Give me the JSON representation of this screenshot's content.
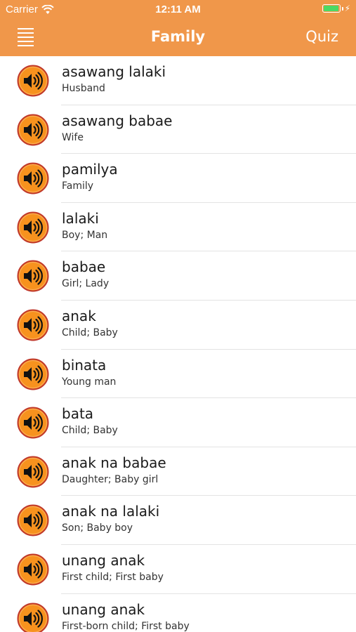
{
  "colors": {
    "accent": "#f0974a",
    "speaker_fill": "#f7921e",
    "speaker_ring": "#c0392b",
    "battery_fill": "#4cd964"
  },
  "status_bar": {
    "carrier": "Carrier",
    "time": "12:11 AM",
    "icons": [
      "wifi-icon",
      "battery-icon",
      "charging-bolt-icon"
    ]
  },
  "navbar": {
    "menu_icon": "hamburger-menu-icon",
    "title": "Family",
    "right_button": "Quiz"
  },
  "items": [
    {
      "word": "asawang lalaki",
      "translation": "Husband",
      "icon": "speaker-icon"
    },
    {
      "word": "asawang babae",
      "translation": "Wife",
      "icon": "speaker-icon"
    },
    {
      "word": "pamilya",
      "translation": "Family",
      "icon": "speaker-icon"
    },
    {
      "word": "lalaki",
      "translation": "Boy; Man",
      "icon": "speaker-icon"
    },
    {
      "word": "babae",
      "translation": "Girl; Lady",
      "icon": "speaker-icon"
    },
    {
      "word": "anak",
      "translation": "Child; Baby",
      "icon": "speaker-icon"
    },
    {
      "word": "binata",
      "translation": "Young man",
      "icon": "speaker-icon"
    },
    {
      "word": "bata",
      "translation": "Child; Baby",
      "icon": "speaker-icon"
    },
    {
      "word": "anak na babae",
      "translation": "Daughter; Baby girl",
      "icon": "speaker-icon"
    },
    {
      "word": "anak na lalaki",
      "translation": "Son; Baby boy",
      "icon": "speaker-icon"
    },
    {
      "word": "unang anak",
      "translation": "First child; First baby",
      "icon": "speaker-icon"
    },
    {
      "word": "unang anak",
      "translation": "First-born child; First baby",
      "icon": "speaker-icon"
    }
  ]
}
